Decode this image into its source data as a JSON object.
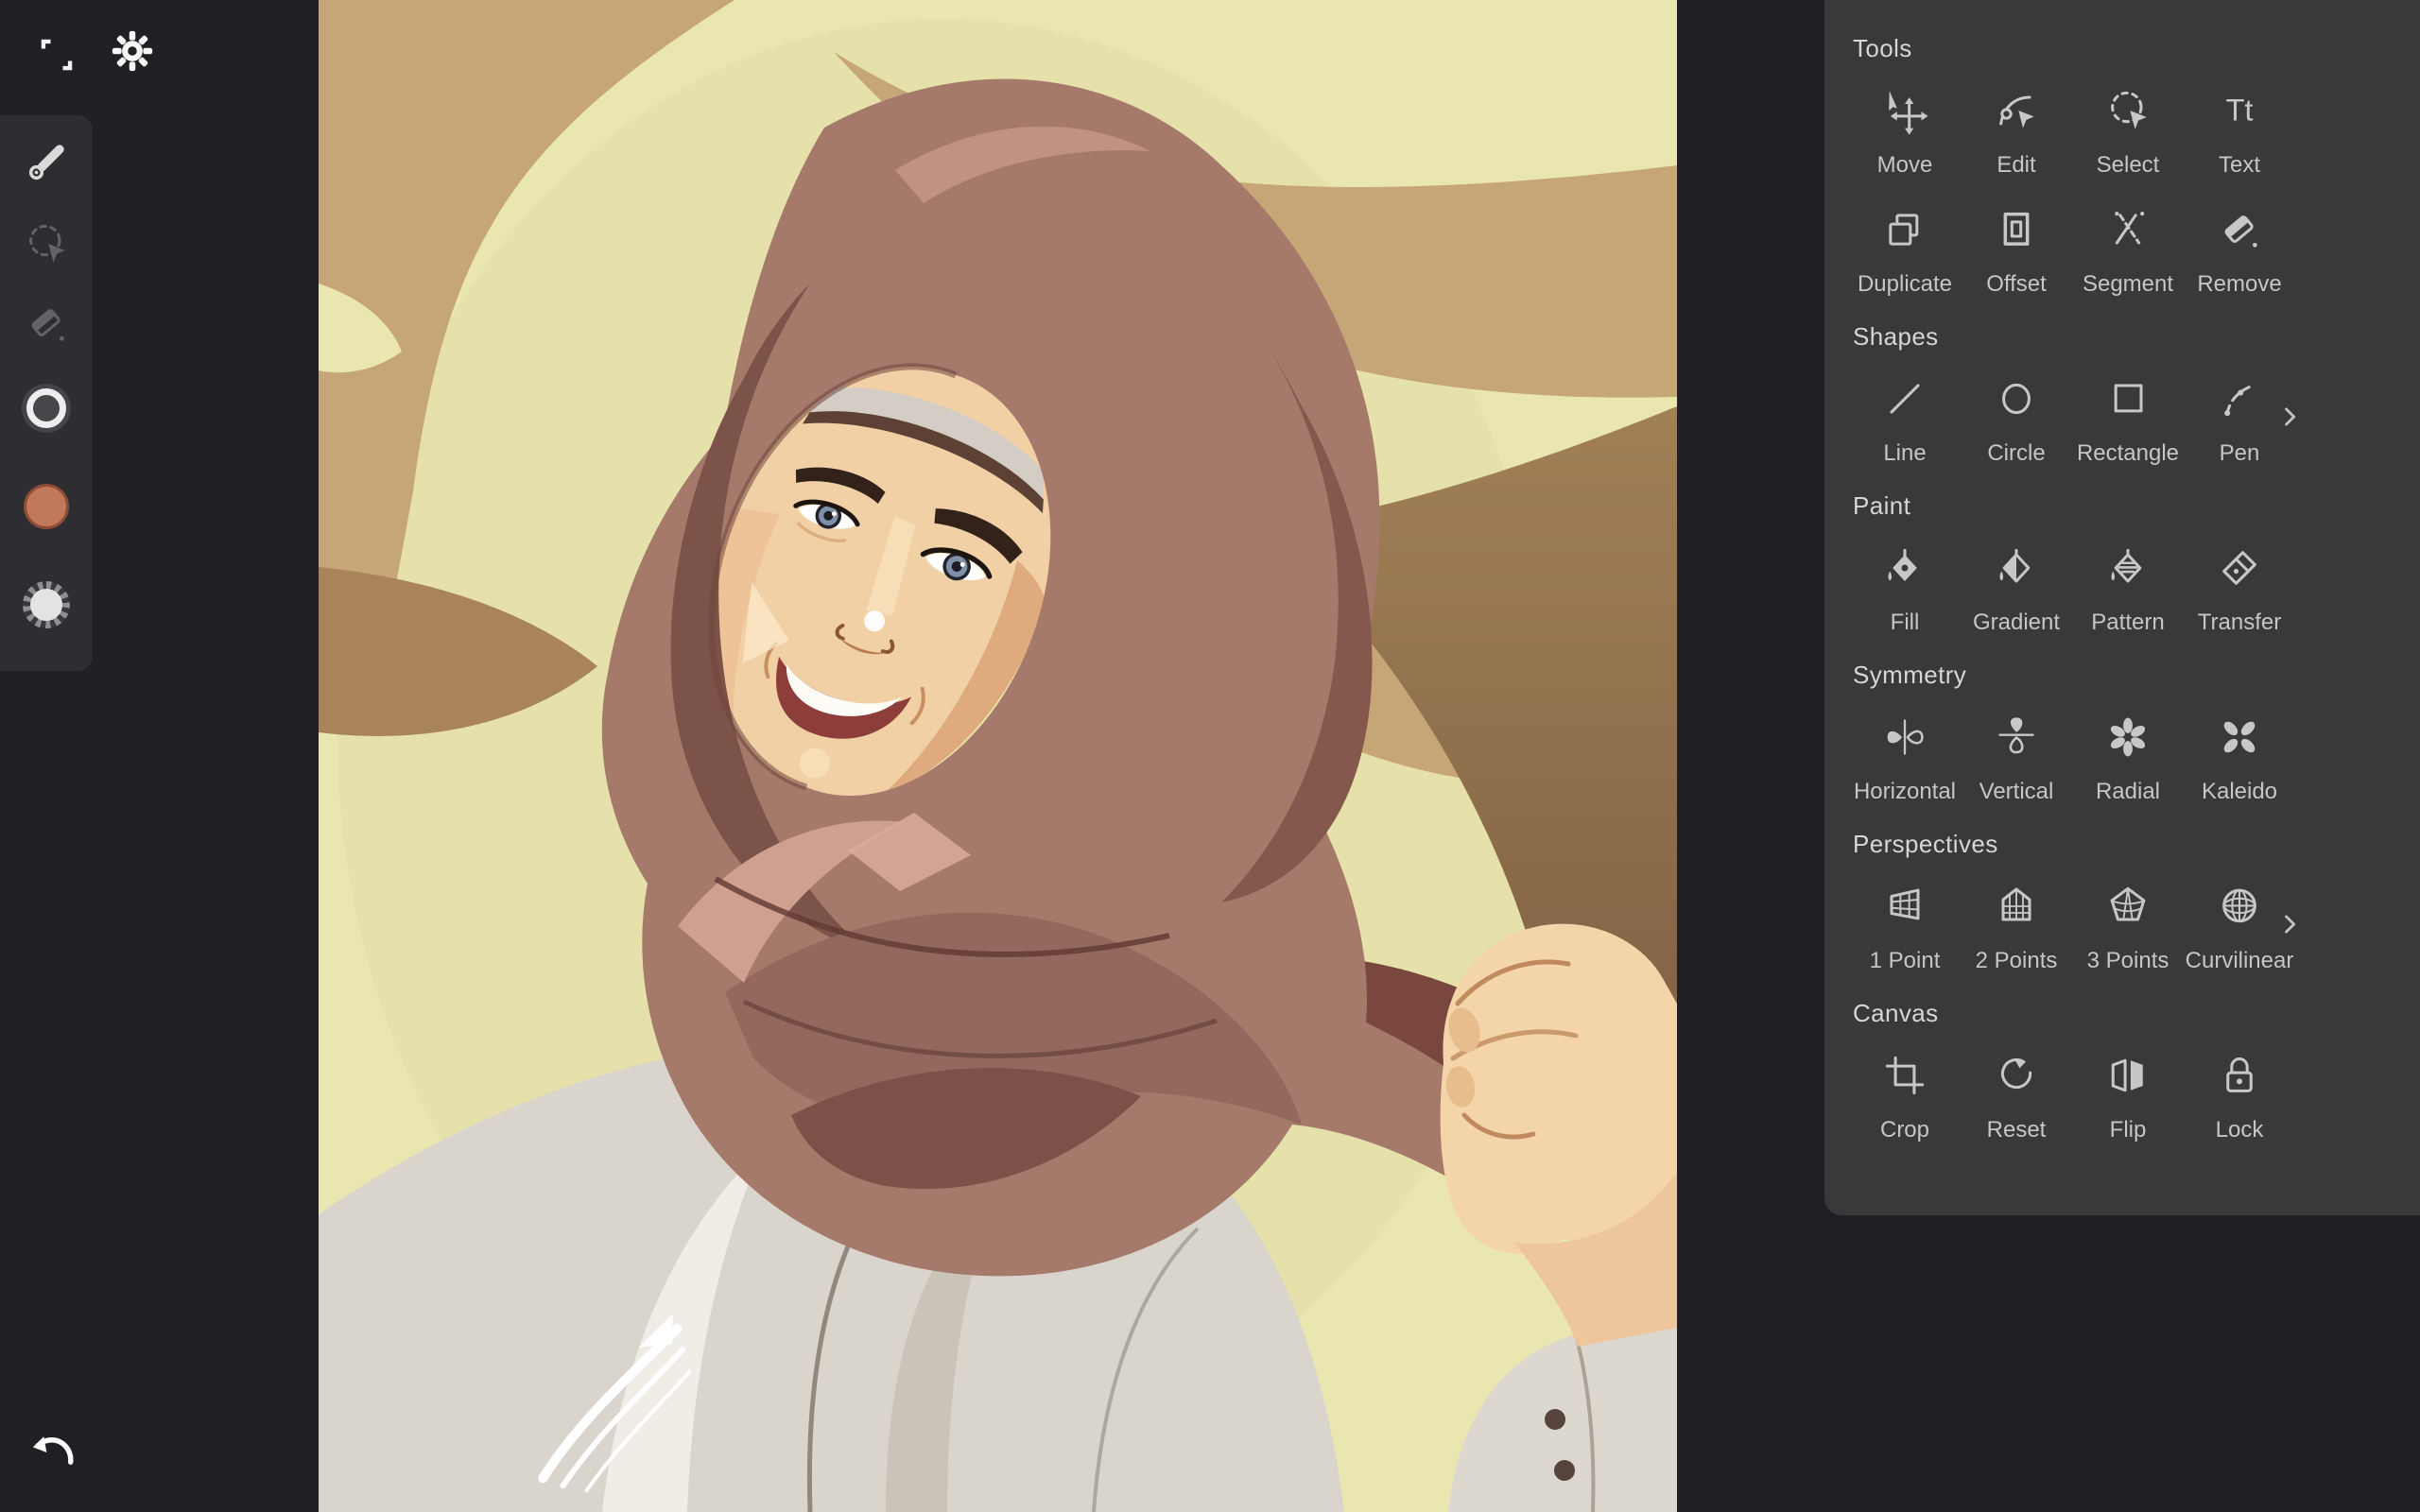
{
  "window": {
    "background": "#201f23"
  },
  "topbar": {
    "icons": [
      {
        "name": "expand-icon"
      },
      {
        "name": "settings-gear-icon"
      }
    ]
  },
  "left_toolbar": {
    "background": "#2e2d31",
    "items": [
      {
        "type": "icon",
        "icon": "pen-tool",
        "name": "pen-tool-button",
        "active": true
      },
      {
        "type": "icon",
        "icon": "lasso-select",
        "name": "select-tool-button",
        "active": false
      },
      {
        "type": "icon",
        "icon": "eraser",
        "name": "eraser-tool-button",
        "active": false
      },
      {
        "type": "swatch-ring",
        "name": "stroke-color-swatch",
        "ring": "#ededed",
        "inner": "#47464a"
      },
      {
        "type": "swatch-fill",
        "name": "fill-color-swatch",
        "fill": "#c1795a",
        "ring": "#8d4c36"
      },
      {
        "type": "swatch-alpha",
        "name": "opacity-swatch",
        "fill": "#e3e3e3",
        "checker_dark": "#3a393d",
        "checker_light": "#8f8f95"
      }
    ]
  },
  "undo": {
    "name": "undo-button"
  },
  "right_panel": {
    "background": "#39383b",
    "sections": [
      {
        "title": "Tools",
        "chevron": false,
        "items": [
          {
            "label": "Move",
            "icon": "move"
          },
          {
            "label": "Edit",
            "icon": "edit"
          },
          {
            "label": "Select",
            "icon": "select"
          },
          {
            "label": "Text",
            "icon": "text"
          },
          {
            "label": "Duplicate",
            "icon": "duplicate"
          },
          {
            "label": "Offset",
            "icon": "offset"
          },
          {
            "label": "Segment",
            "icon": "segment"
          },
          {
            "label": "Remove",
            "icon": "remove"
          }
        ]
      },
      {
        "title": "Shapes",
        "chevron": true,
        "items": [
          {
            "label": "Line",
            "icon": "line"
          },
          {
            "label": "Circle",
            "icon": "circle"
          },
          {
            "label": "Rectangle",
            "icon": "rectangle"
          },
          {
            "label": "Pen",
            "icon": "pen"
          }
        ]
      },
      {
        "title": "Paint",
        "chevron": false,
        "items": [
          {
            "label": "Fill",
            "icon": "fill"
          },
          {
            "label": "Gradient",
            "icon": "gradient"
          },
          {
            "label": "Pattern",
            "icon": "pattern"
          },
          {
            "label": "Transfer",
            "icon": "transfer"
          }
        ]
      },
      {
        "title": "Symmetry",
        "chevron": false,
        "items": [
          {
            "label": "Horizontal",
            "icon": "sym-horizontal"
          },
          {
            "label": "Vertical",
            "icon": "sym-vertical"
          },
          {
            "label": "Radial",
            "icon": "sym-radial"
          },
          {
            "label": "Kaleido",
            "icon": "sym-kaleido"
          }
        ]
      },
      {
        "title": "Perspectives",
        "chevron": true,
        "items": [
          {
            "label": "1 Point",
            "icon": "persp-1point"
          },
          {
            "label": "2 Points",
            "icon": "persp-2points"
          },
          {
            "label": "3 Points",
            "icon": "persp-3points"
          },
          {
            "label": "Curvilinear",
            "icon": "persp-curvilinear"
          }
        ]
      },
      {
        "title": "Canvas",
        "chevron": false,
        "items": [
          {
            "label": "Crop",
            "icon": "crop"
          },
          {
            "label": "Reset",
            "icon": "reset"
          },
          {
            "label": "Flip",
            "icon": "flip"
          },
          {
            "label": "Lock",
            "icon": "lock"
          }
        ]
      }
    ]
  },
  "canvas": {
    "palette": {
      "background": "#eae6af",
      "swoosh_tan": "#c6a676",
      "shadow_band_top": "#a18057",
      "shadow_band_bottom": "#6b4c36",
      "hijab": "#a57a6b",
      "hijab_dark": "#7c5348",
      "hijab_highlight": "#c49486",
      "skin": "#f2d0a6",
      "skin_shadow": "#dfab7e",
      "garment": "#d9d5cc",
      "eyes": "#7e91a8",
      "lips": "#8e3e3a",
      "signature": "#ffffff"
    }
  }
}
